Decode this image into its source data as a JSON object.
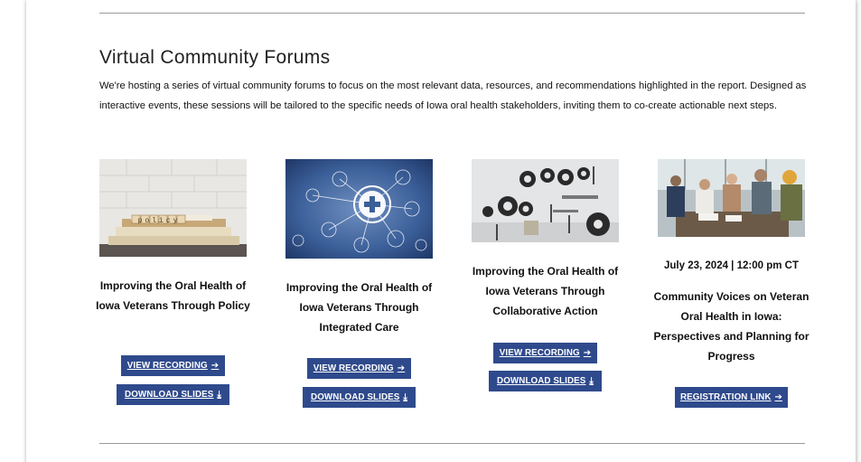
{
  "section": {
    "heading": "Virtual Community Forums",
    "intro": "We're hosting a series of virtual community forums to focus on the most relevant data, resources, and recommendations highlighted in the report. Designed as interactive events, these sessions will be tailored to the specific needs of Iowa oral health stakeholders, inviting them to co-create actionable next steps."
  },
  "cards": [
    {
      "image_label": "policy",
      "title": "Improving the Oral Health of Iowa Veterans Through Policy",
      "primary_label": "VIEW RECORDING",
      "primary_icon": "arrow-right-icon",
      "secondary_label": "DOWNLOAD SLIDES",
      "secondary_icon": "download-icon"
    },
    {
      "title": "Improving the Oral Health of Iowa Veterans Through Integrated Care",
      "primary_label": "VIEW RECORDING",
      "primary_icon": "arrow-right-icon",
      "secondary_label": "DOWNLOAD SLIDES",
      "secondary_icon": "download-icon"
    },
    {
      "title": "Improving the Oral Health of Iowa Veterans Through Collaborative Action",
      "primary_label": "VIEW RECORDING",
      "primary_icon": "arrow-right-icon",
      "secondary_label": "DOWNLOAD SLIDES",
      "secondary_icon": "download-icon"
    },
    {
      "date": "July 23, 2024  |  12:00 pm CT",
      "title": "Community Voices on Veteran Oral Health in Iowa: Perspectives and Planning for Progress",
      "primary_label": "REGISTRATION LINK",
      "primary_icon": "arrow-right-icon"
    }
  ],
  "colors": {
    "button": "#2f4a8c",
    "button_text": "#ffffff",
    "rule": "#9a9a9a"
  }
}
